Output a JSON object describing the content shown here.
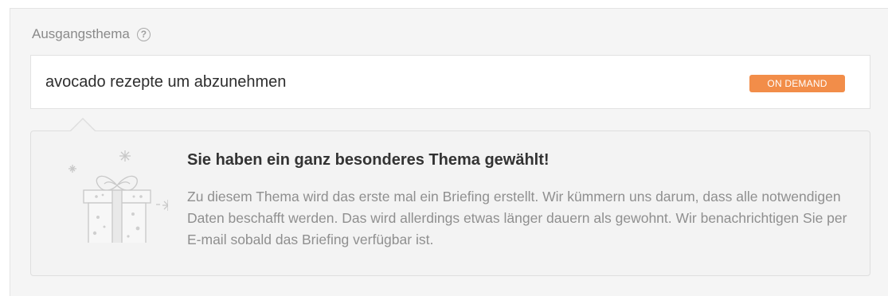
{
  "field": {
    "label": "Ausgangsthema",
    "value": "avocado rezepte um abzunehmen",
    "badge": "ON DEMAND"
  },
  "info": {
    "title": "Sie haben ein ganz besonderes Thema gewählt!",
    "body": "Zu diesem Thema wird das erste mal ein Briefing erstellt. Wir kümmern uns darum, dass alle notwendigen Daten beschafft werden. Das wird allerdings etwas länger dauern als gewohnt. Wir benachrichtigen Sie per E-mail sobald das Briefing verfügbar ist."
  },
  "icons": {
    "help": "question-circle-icon",
    "illustration": "gift-box-icon"
  },
  "colors": {
    "badge": "#f28d49",
    "panel": "#f5f5f5"
  }
}
